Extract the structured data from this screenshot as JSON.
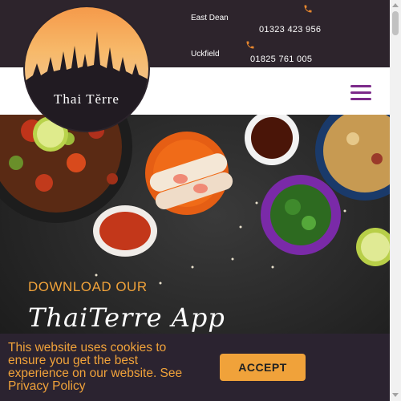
{
  "header": {
    "locations": [
      {
        "name": "East Dean",
        "phone": "01323 423 956"
      },
      {
        "name": "Uckfield",
        "phone": "01825 761 005"
      }
    ]
  },
  "logo": {
    "text": "Thai Tĕrre"
  },
  "nav": {
    "menu_icon": "hamburger-menu-icon"
  },
  "hero": {
    "download_text": "DOWNLOAD OUR",
    "app_name": "ThaiTerre App"
  },
  "cookie_banner": {
    "message": "This website uses cookies to ensure you get the best experience on our website. See",
    "link_text": "Privacy Policy",
    "accept_label": "ACCEPT"
  },
  "colors": {
    "accent": "#f0a23a",
    "menu_purple": "#7c2a8a",
    "header_bg": "#2d242c",
    "phone_icon": "#e8872e"
  }
}
